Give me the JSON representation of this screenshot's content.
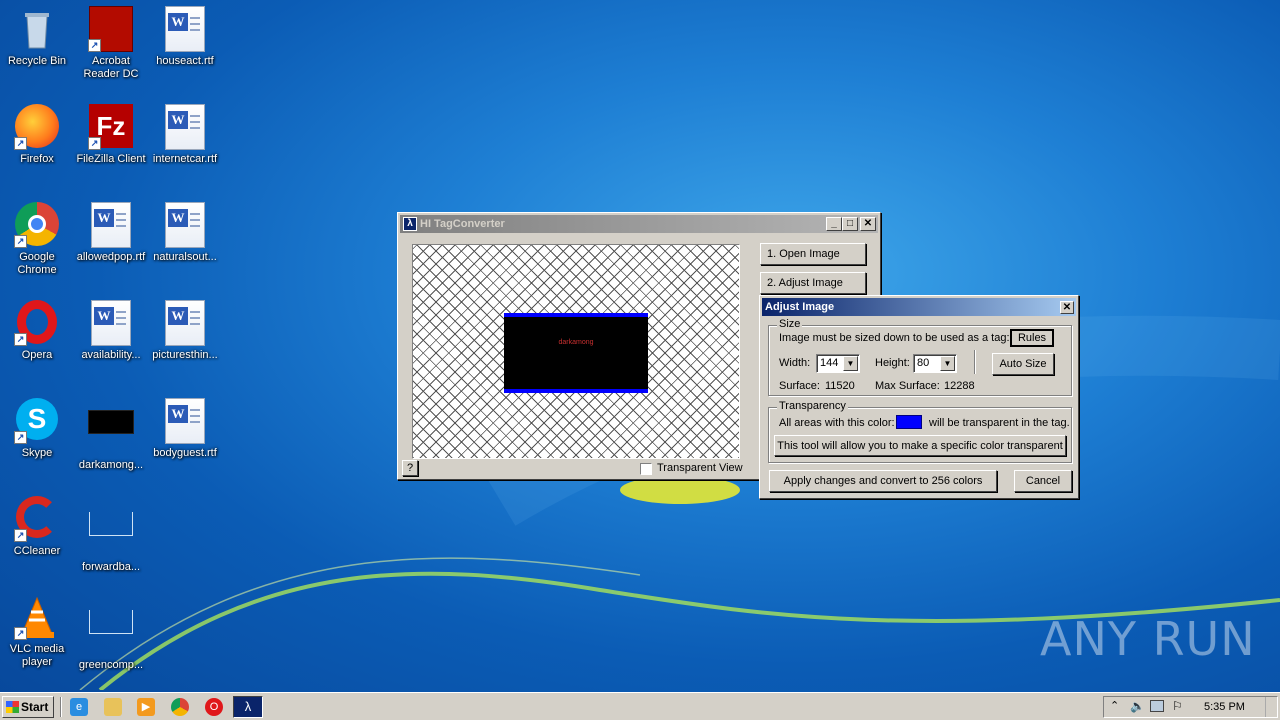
{
  "desktop": {
    "icons": [
      {
        "label": "Recycle Bin"
      },
      {
        "label": "Acrobat Reader DC"
      },
      {
        "label": "houseact.rtf"
      },
      {
        "label": "Firefox"
      },
      {
        "label": "FileZilla Client"
      },
      {
        "label": "internetcar.rtf"
      },
      {
        "label": "Google Chrome"
      },
      {
        "label": "allowedpop.rtf"
      },
      {
        "label": "naturalsout..."
      },
      {
        "label": "Opera"
      },
      {
        "label": "availability..."
      },
      {
        "label": "picturesthin..."
      },
      {
        "label": "Skype"
      },
      {
        "label": "darkamong..."
      },
      {
        "label": "bodyguest.rtf"
      },
      {
        "label": "CCleaner"
      },
      {
        "label": "forwardba..."
      },
      {
        "label": "VLC media player"
      },
      {
        "label": "greencomp..."
      }
    ]
  },
  "tagconverter": {
    "title": "HI TagConverter",
    "open_image": "1.  Open Image",
    "adjust_image": "2.  Adjust Image",
    "preview_text": "darkamong",
    "help_button": "?",
    "transparent_view": "Transparent View"
  },
  "adjust": {
    "title": "Adjust Image",
    "size_legend": "Size",
    "size_message": "Image must be sized down to be used as a tag:",
    "rules_button": "Rules",
    "width_label": "Width:",
    "width_value": "144",
    "height_label": "Height:",
    "height_value": "80",
    "autosize_button": "Auto Size",
    "surface_label": "Surface:",
    "surface_value": "11520",
    "max_surface_label": "Max Surface:",
    "max_surface_value": "12288",
    "transparency_legend": "Transparency",
    "all_areas_text": "All areas with this color:",
    "transparent_text": "will be transparent in the tag.",
    "transparent_color": "#0000ff",
    "tool_button": "This tool will allow you to make a specific color transparent",
    "apply_button": "Apply changes and convert to 256 colors",
    "cancel_button": "Cancel"
  },
  "taskbar": {
    "start_label": "Start",
    "clock": "5:35 PM"
  },
  "watermark": "ANY RUN"
}
